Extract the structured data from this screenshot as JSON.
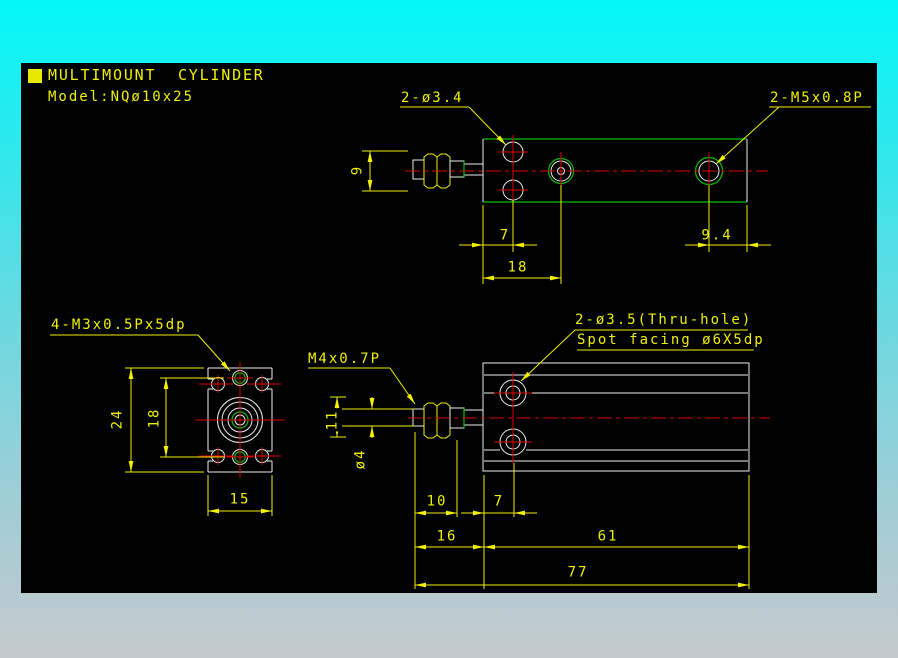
{
  "header": {
    "title": "MULTIMOUNT  CYLINDER",
    "model": "Model:NQø10x25"
  },
  "top_view": {
    "leader_holes": "2-ø3.4",
    "leader_ports": "2-M5x0.8P",
    "dim_rod_width": "9",
    "dim_hole_offset": "7",
    "dim_port_center": "18",
    "dim_port_right": "9.4"
  },
  "front_view": {
    "leader_thru_hole": "2-ø3.5(Thru-hole)",
    "leader_spot_facing": "Spot facing ø6X5dp",
    "leader_rod_thread": "M4x0.7P",
    "dim_nut_width": "11",
    "dim_rod_dia": "ø4",
    "dim_rod_front": "10",
    "dim_hole_offset": "7",
    "dim_rod_total": "16",
    "dim_body_length": "61",
    "dim_overall_length": "77"
  },
  "end_view": {
    "leader_tapped": "4-M3x0.5Px5dp",
    "dim_body_height": "24",
    "dim_tap_span": "18",
    "dim_body_width": "15"
  },
  "colors": {
    "dimension_yellow": "#f0f000",
    "outline_white": "#ececec",
    "thread_green": "#00c000",
    "centerline_red": "#dd0000",
    "canvas_black": "#000000",
    "frame_cyan": "#04f8f8"
  }
}
